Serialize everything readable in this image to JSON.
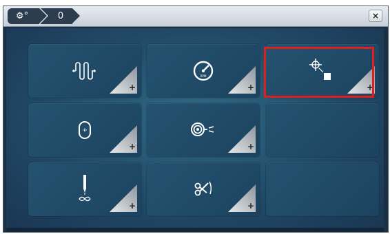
{
  "window": {
    "breadcrumb": [
      {
        "label": "⚙°",
        "icon": "settings-icon"
      },
      {
        "label": "0",
        "icon": "zero-icon"
      }
    ],
    "close_label": "×"
  },
  "tiles": [
    {
      "id": "tile-stitch-pattern",
      "icon": "stitch-pattern-icon",
      "plus": "+"
    },
    {
      "id": "tile-speed",
      "icon": "speedometer-icon",
      "plus": "+"
    },
    {
      "id": "tile-position",
      "icon": "crosshair-position-icon",
      "plus": "+",
      "selected": true
    },
    {
      "id": "tile-hoop",
      "icon": "hoop-icon",
      "plus": "+"
    },
    {
      "id": "tile-thread",
      "icon": "thread-spool-icon",
      "plus": "+"
    },
    {
      "id": "tile-empty-1",
      "icon": ""
    },
    {
      "id": "tile-needle",
      "icon": "needle-icon",
      "plus": "+"
    },
    {
      "id": "tile-cutter",
      "icon": "scissors-icon",
      "plus": "+"
    },
    {
      "id": "tile-empty-2",
      "icon": ""
    }
  ],
  "colors": {
    "selection": "#e0201c",
    "panel": "#214a68",
    "tile": "#24536f"
  }
}
